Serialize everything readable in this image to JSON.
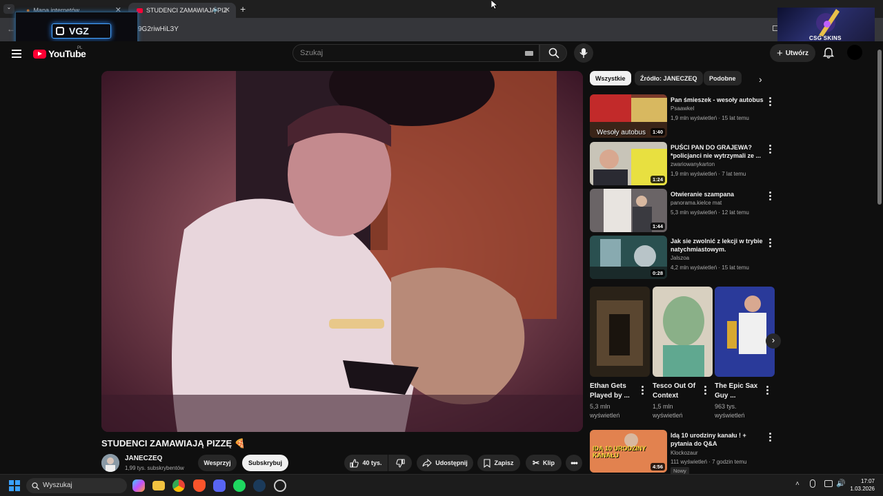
{
  "browser": {
    "tabs": [
      {
        "title": "Mapa internetów"
      },
      {
        "title": "STUDENCI ZAMAWIAJĄ PIZ"
      }
    ],
    "new_tab": "+",
    "url_fragment": "9G2riwHiL3Y"
  },
  "overlays": {
    "vgz_logo": "VGZ",
    "csg_logo": "CSG SKINS"
  },
  "youtube": {
    "logo": "YouTube",
    "region": "PL",
    "search_placeholder": "Szukaj",
    "create_label": "Utwórz"
  },
  "video": {
    "title": "STUDENCI ZAMAWIAJĄ PIZZĘ 🍕",
    "channel": "JANECZEQ",
    "subscribers": "1,99 tys. subskrybentów",
    "support_label": "Wesprzyj",
    "subscribe_label": "Subskrybuj",
    "likes": "40 tys.",
    "share_label": "Udostępnij",
    "save_label": "Zapisz",
    "clip_label": "Klip"
  },
  "chips": [
    {
      "label": "Wszystkie",
      "active": true
    },
    {
      "label": "Źródło: JANECZEQ",
      "active": false
    },
    {
      "label": "Podobne",
      "active": false
    }
  ],
  "recommendations": [
    {
      "title": "Pan śmieszek - wesoły autobus",
      "channel": "Psaawkel",
      "meta": "1,9 mln wyświetleń · 15 lat temu",
      "duration": "1:40",
      "thumb_text": "Wesoły autobus"
    },
    {
      "title": "PUŚCI PAN DO GRAJEWA? *policjanci nie wytrzymali ze ...",
      "channel": "zwariowanykarton",
      "meta": "1,9 mln wyświetleń · 7 lat temu",
      "duration": "1:24"
    },
    {
      "title": "Otwieranie szampana",
      "channel": "panorama.kielce mat",
      "meta": "5,3 mln wyświetleń · 12 lat temu",
      "duration": "1:44"
    },
    {
      "title": "Jak sie zwolnić z lekcji w trybie natychmiastowym.",
      "channel": "Jalszoa",
      "meta": "4,2 mln wyświetleń · 15 lat temu",
      "duration": "0:28"
    }
  ],
  "shorts": [
    {
      "title": "Ethan Gets Played by ...",
      "views": "5,3 mln wyświetleń"
    },
    {
      "title": "Tesco Out Of Context",
      "views": "1,5 mln wyświetleń"
    },
    {
      "title": "The Epic Sax Guy ...",
      "views": "963 tys. wyświetleń"
    }
  ],
  "rec5": {
    "title": "Idą 10 urodziny kanału ! + pytania do Q&A",
    "channel": "Klockozaur",
    "meta": "111 wyświetleń · 7 godzin temu",
    "badge": "Nowy",
    "duration": "4:56",
    "thumb_text": "IDĄ 10 URODZINY KANAŁU"
  },
  "taskbar": {
    "search_placeholder": "Wyszukaj",
    "time": "17:07",
    "date": "1.03.2026"
  }
}
